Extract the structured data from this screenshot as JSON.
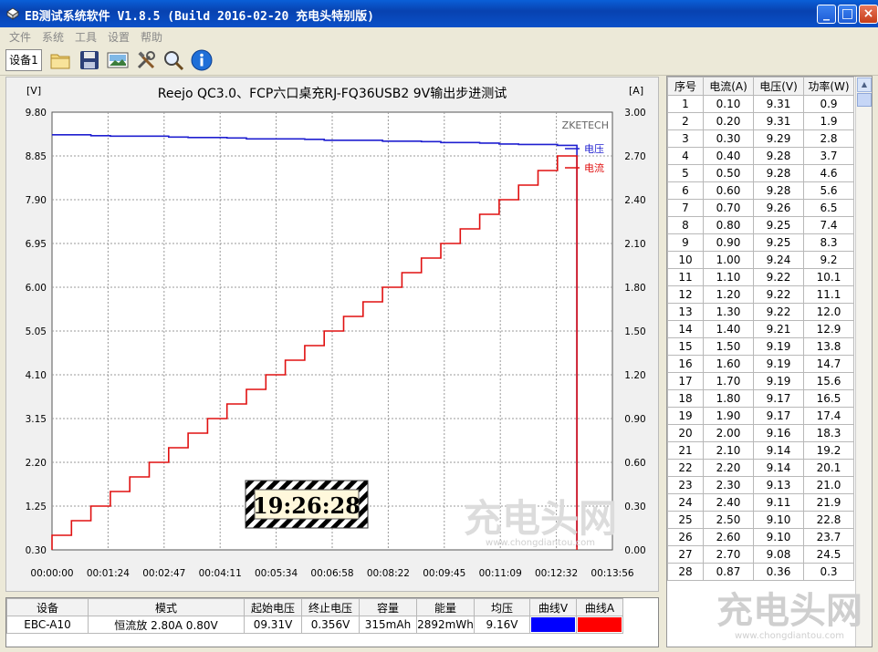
{
  "window": {
    "title": "EB测试系统软件 V1.8.5 (Build 2016-02-20 充电头特别版)",
    "buttons": [
      "_",
      "□",
      "×"
    ]
  },
  "menu": [
    "文件",
    "系统",
    "工具",
    "设置",
    "帮助"
  ],
  "toolbar": {
    "device_tab": "设备1",
    "icons": [
      "folder-icon",
      "save-icon",
      "image-icon",
      "tools-icon",
      "search-icon",
      "info-icon"
    ]
  },
  "chart_data": {
    "type": "line",
    "title": "Reejo QC3.0、FCP六口桌充RJ-FQ36USB2 9V输出步进测试",
    "brand": "ZKETECH",
    "left_unit": "[V]",
    "right_unit": "[A]",
    "y_left_ticks": [
      "9.80",
      "8.85",
      "7.90",
      "6.95",
      "6.00",
      "5.05",
      "4.10",
      "3.15",
      "2.20",
      "1.25",
      "0.30"
    ],
    "y_left_range": [
      0.3,
      9.8
    ],
    "y_right_ticks": [
      "3.00",
      "2.70",
      "2.40",
      "2.10",
      "1.80",
      "1.50",
      "1.20",
      "0.90",
      "0.60",
      "0.30",
      "0.00"
    ],
    "y_right_range": [
      0.0,
      3.0
    ],
    "x_ticks": [
      "00:00:00",
      "00:01:24",
      "00:02:47",
      "00:04:11",
      "00:05:34",
      "00:06:58",
      "00:08:22",
      "00:09:45",
      "00:11:09",
      "00:12:32",
      "00:13:56"
    ],
    "x_range_seconds": [
      0,
      836
    ],
    "step_seconds": 29,
    "legend": [
      "电压",
      "电流"
    ],
    "colors": {
      "voltage": "#1f1fd0",
      "current": "#e01010"
    },
    "series": [
      {
        "name": "电压",
        "axis": "left",
        "step_values": [
          9.31,
          9.31,
          9.29,
          9.28,
          9.28,
          9.28,
          9.26,
          9.25,
          9.25,
          9.24,
          9.22,
          9.22,
          9.22,
          9.21,
          9.19,
          9.19,
          9.19,
          9.17,
          9.17,
          9.16,
          9.14,
          9.14,
          9.13,
          9.11,
          9.1,
          9.1,
          9.08
        ],
        "tail_value": 0.36
      },
      {
        "name": "电流",
        "axis": "right",
        "step_values": [
          0.1,
          0.2,
          0.3,
          0.4,
          0.5,
          0.6,
          0.7,
          0.8,
          0.9,
          1.0,
          1.1,
          1.2,
          1.3,
          1.4,
          1.5,
          1.6,
          1.7,
          1.8,
          1.9,
          2.0,
          2.1,
          2.2,
          2.3,
          2.4,
          2.5,
          2.6,
          2.7
        ],
        "tail_value": 0.0
      }
    ],
    "timer": "19:26:28",
    "watermark": {
      "main": "充电头网",
      "url": "www.chongdiantou.com"
    }
  },
  "results_table": {
    "headers": [
      "序号",
      "电流(A)",
      "电压(V)",
      "功率(W)"
    ],
    "rows": [
      [
        "1",
        "0.10",
        "9.31",
        "0.9"
      ],
      [
        "2",
        "0.20",
        "9.31",
        "1.9"
      ],
      [
        "3",
        "0.30",
        "9.29",
        "2.8"
      ],
      [
        "4",
        "0.40",
        "9.28",
        "3.7"
      ],
      [
        "5",
        "0.50",
        "9.28",
        "4.6"
      ],
      [
        "6",
        "0.60",
        "9.28",
        "5.6"
      ],
      [
        "7",
        "0.70",
        "9.26",
        "6.5"
      ],
      [
        "8",
        "0.80",
        "9.25",
        "7.4"
      ],
      [
        "9",
        "0.90",
        "9.25",
        "8.3"
      ],
      [
        "10",
        "1.00",
        "9.24",
        "9.2"
      ],
      [
        "11",
        "1.10",
        "9.22",
        "10.1"
      ],
      [
        "12",
        "1.20",
        "9.22",
        "11.1"
      ],
      [
        "13",
        "1.30",
        "9.22",
        "12.0"
      ],
      [
        "14",
        "1.40",
        "9.21",
        "12.9"
      ],
      [
        "15",
        "1.50",
        "9.19",
        "13.8"
      ],
      [
        "16",
        "1.60",
        "9.19",
        "14.7"
      ],
      [
        "17",
        "1.70",
        "9.19",
        "15.6"
      ],
      [
        "18",
        "1.80",
        "9.17",
        "16.5"
      ],
      [
        "19",
        "1.90",
        "9.17",
        "17.4"
      ],
      [
        "20",
        "2.00",
        "9.16",
        "18.3"
      ],
      [
        "21",
        "2.10",
        "9.14",
        "19.2"
      ],
      [
        "22",
        "2.20",
        "9.14",
        "20.1"
      ],
      [
        "23",
        "2.30",
        "9.13",
        "21.0"
      ],
      [
        "24",
        "2.40",
        "9.11",
        "21.9"
      ],
      [
        "25",
        "2.50",
        "9.10",
        "22.8"
      ],
      [
        "26",
        "2.60",
        "9.10",
        "23.7"
      ],
      [
        "27",
        "2.70",
        "9.08",
        "24.5"
      ],
      [
        "28",
        "0.87",
        "0.36",
        "0.3"
      ]
    ]
  },
  "summary": {
    "headers": [
      "设备",
      "模式",
      "起始电压",
      "终止电压",
      "容量",
      "能量",
      "均压",
      "曲线V",
      "曲线A"
    ],
    "values": [
      "EBC-A10",
      "恒流放 2.80A 0.80V",
      "09.31V",
      "0.356V",
      "315mAh",
      "2892mWh",
      "9.16V"
    ],
    "curve_colors": [
      "#0000ff",
      "#ff0000"
    ]
  },
  "watermark": {
    "main": "充电头网",
    "url": "www.chongdiantou.com"
  }
}
